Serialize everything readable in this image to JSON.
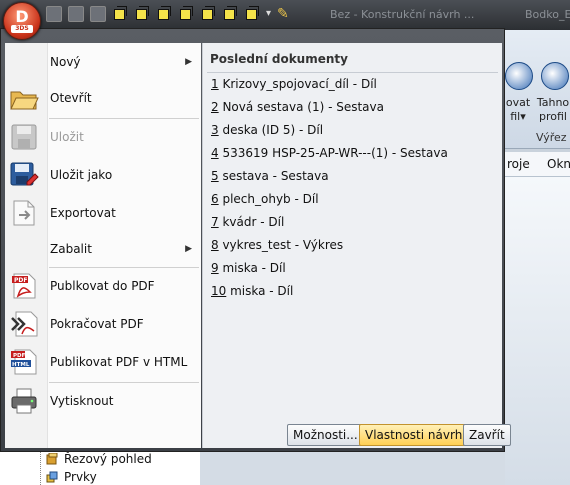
{
  "window": {
    "title_fragment": "Bez - Konstrukční návrh ...",
    "title_fragment2": "Bodko_Ext"
  },
  "ribbon": {
    "item1_label_line1": "ovat",
    "item1_label_line2": "fil",
    "item2_label_line1": "Tahno",
    "item2_label_line2": "profil",
    "group_label": "Výřez"
  },
  "menubar": {
    "item1": "roje",
    "item2": "Okn"
  },
  "tree": {
    "row1": "Řezový pohled",
    "row2": "Prvky"
  },
  "app_button": {
    "letter": "D",
    "sub": "3DS"
  },
  "menu": {
    "items": [
      {
        "label": "Nový",
        "icon": "blank-icon",
        "submenu": true,
        "enabled": true
      },
      {
        "label": "Otevřít",
        "icon": "open-folder-icon",
        "submenu": false,
        "enabled": true
      },
      {
        "label": "Uložit",
        "icon": "save-icon",
        "submenu": false,
        "enabled": false
      },
      {
        "label": "Uložit jako",
        "icon": "save-as-icon",
        "submenu": false,
        "enabled": true
      },
      {
        "label": "Exportovat",
        "icon": "export-icon",
        "submenu": false,
        "enabled": true
      },
      {
        "label": "Zabalit",
        "icon": "blank-icon",
        "submenu": true,
        "enabled": true
      },
      {
        "label": "Publkovat do PDF",
        "icon": "pdf-icon",
        "submenu": false,
        "enabled": true
      },
      {
        "label": "Pokračovat PDF",
        "icon": "continue-pdf-icon",
        "submenu": false,
        "enabled": true
      },
      {
        "label": "Publikovat PDF v HTML",
        "icon": "pdf-html-icon",
        "submenu": false,
        "enabled": true
      },
      {
        "label": "Vytisknout",
        "icon": "printer-icon",
        "submenu": false,
        "enabled": true
      }
    ]
  },
  "recent": {
    "title": "Poslední dokumenty",
    "documents": [
      {
        "num": "1",
        "name": " Krizovy_spojovací_díl - Díl"
      },
      {
        "num": "2",
        "name": " Nová sestava (1) - Sestava"
      },
      {
        "num": "3",
        "name": " deska (ID 5) - Díl"
      },
      {
        "num": "4",
        "name": " 533619 HSP-25-AP-WR---(1) - Sestava"
      },
      {
        "num": "5",
        "name": " sestava - Sestava"
      },
      {
        "num": "6",
        "name": " plech_ohyb - Díl"
      },
      {
        "num": "7",
        "name": " kvádr - Díl"
      },
      {
        "num": "8",
        "name": " vykres_test - Výkres"
      },
      {
        "num": "9",
        "name": " miska - Díl"
      },
      {
        "num": "10",
        "name": " miska - Díl"
      }
    ]
  },
  "buttons": {
    "options": "Možnosti...",
    "design_properties": "Vlastnosti návrhu",
    "close": "Zavřít"
  },
  "colors": {
    "app_button": "#c9321a",
    "highlight_button": "#ffcf55",
    "menu_frame": "#4a4e54"
  }
}
